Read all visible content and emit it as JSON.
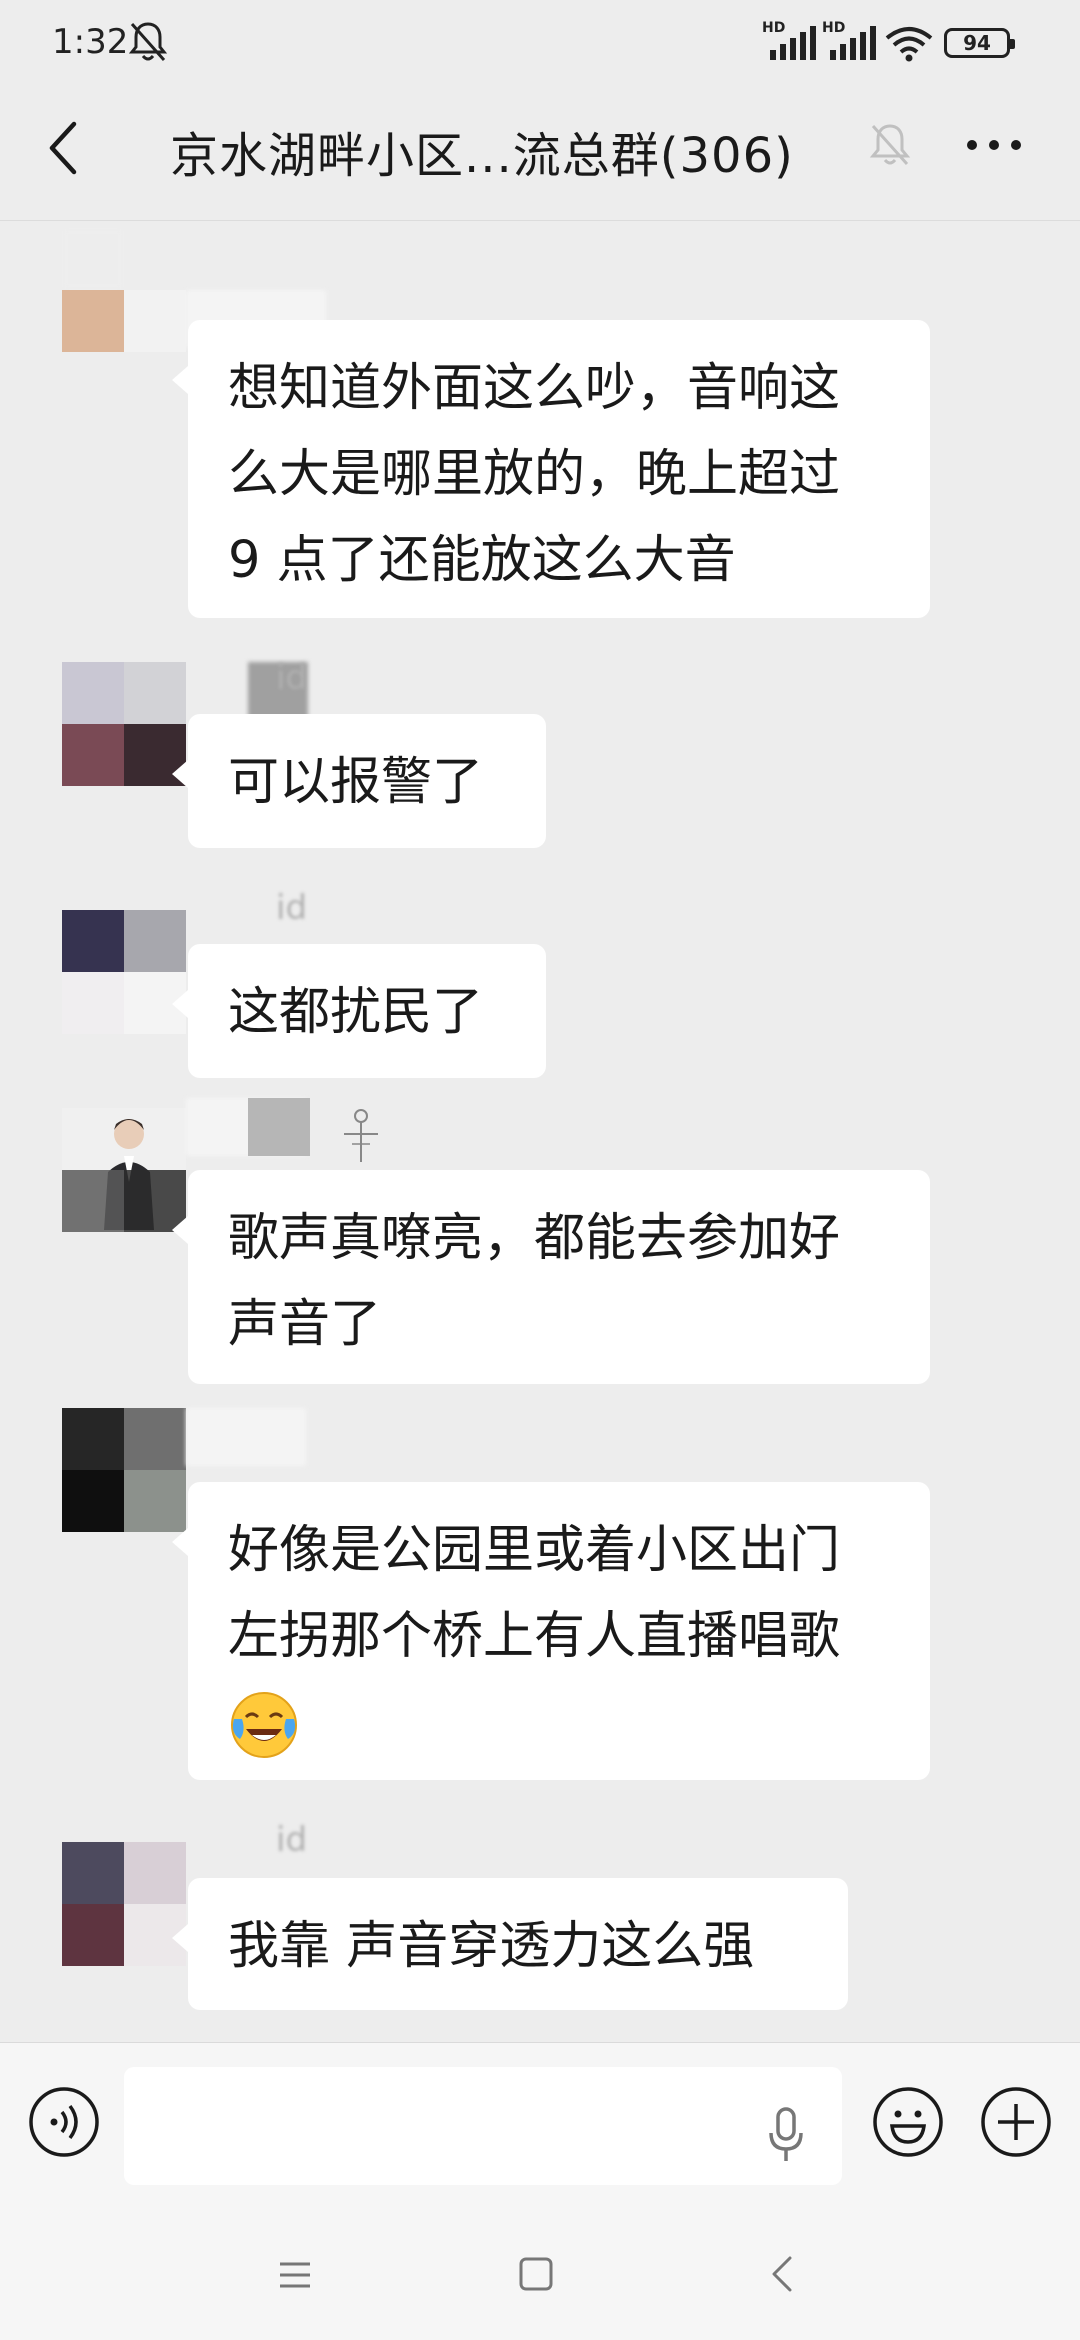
{
  "status_bar": {
    "time": "1:32",
    "signal_1_label": "HD",
    "signal_2_label": "HD",
    "battery": "94"
  },
  "header": {
    "title": "京水湖畔小区...流总群(306)"
  },
  "messages": [
    {
      "name": "",
      "text_lines": [
        "想知道外面这么吵，音响这",
        "么大是哪里放的，晚上超过",
        "9 点了还能放这么大音"
      ]
    },
    {
      "name": "id",
      "text_lines": [
        "可以报警了"
      ]
    },
    {
      "name": "id",
      "text_lines": [
        "这都扰民了"
      ]
    },
    {
      "name": "",
      "text_lines": [
        "歌声真嘹亮，都能去参加好",
        "声音了"
      ]
    },
    {
      "name": "",
      "text_lines": [
        "好像是公园里或着小区出门",
        "左拐那个桥上有人直播唱歌"
      ],
      "emoji": "crying-laughing"
    },
    {
      "name": "id",
      "text_lines": [
        "我靠 声音穿透力这么强"
      ]
    }
  ],
  "input": {
    "value": "",
    "placeholder": ""
  },
  "colors": {
    "background": "#ededed",
    "bubble": "#ffffff",
    "text": "#1a1a1a"
  }
}
